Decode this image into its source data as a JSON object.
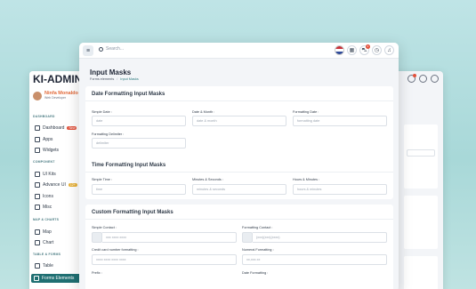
{
  "back": {
    "logo": "KI-ADMIN",
    "user": {
      "name": "Ninfa Monaldo",
      "role": "Web Developer"
    },
    "sections": {
      "dashboard": "DASHBOARD",
      "component": "COMPONENT",
      "maps": "MAP & CHARTS",
      "table": "TABLE & FORMS"
    },
    "nav": {
      "dashboard": "Dashboard",
      "dashboard_badge": "New",
      "apps": "Apps",
      "widgets": "Widgets",
      "ui_kits": "UI Kits",
      "advance_ui": "Advance UI",
      "advance_badge": "12+",
      "icons": "Icons",
      "misc": "Misc",
      "map": "Map",
      "chart": "Chart",
      "table": "Table",
      "forms": "Forms Elements"
    }
  },
  "front": {
    "search_placeholder": "Search...",
    "cart_count": "4",
    "page_title": "Input Masks",
    "breadcrumb": {
      "parent": "Forms elements",
      "current": "Input Masks"
    },
    "date_card": {
      "title": "Date Formatting Input Masks",
      "fields": [
        {
          "label": "Simple Date :",
          "placeholder": "date"
        },
        {
          "label": "Date & Month :",
          "placeholder": "date & month"
        },
        {
          "label": "Formatting Date :",
          "placeholder": "formatting date"
        }
      ],
      "delimiter": {
        "label": "Formatting Delimiter :",
        "placeholder": "delimiter"
      }
    },
    "time_card": {
      "title": "Time Formatting Input Masks",
      "fields": [
        {
          "label": "Simple Time :",
          "placeholder": "time"
        },
        {
          "label": "Minutes & Seconds :",
          "placeholder": "minutes & seconds"
        },
        {
          "label": "Hours & Minutes :",
          "placeholder": "hours & minutes"
        }
      ]
    },
    "custom_card": {
      "title": "Custom Formatting Input Masks",
      "simple_contact": {
        "label": "Simple Contact :",
        "placeholder": "xxx xxxx xxxx"
      },
      "formatting_contact": {
        "label": "Formatting Contact :",
        "placeholder": "(xxx)(xxx)(xxxx)"
      },
      "credit_card": {
        "label": "Credit card number formatting :",
        "placeholder": "xxxx xxxx xxxx xxxx"
      },
      "numeral": {
        "label": "Numeral Formatting :",
        "placeholder": "xx,xxx.xx"
      },
      "prefix": {
        "label": "Prefix :"
      },
      "date_formatting": {
        "label": "Date Formatting :"
      }
    }
  }
}
